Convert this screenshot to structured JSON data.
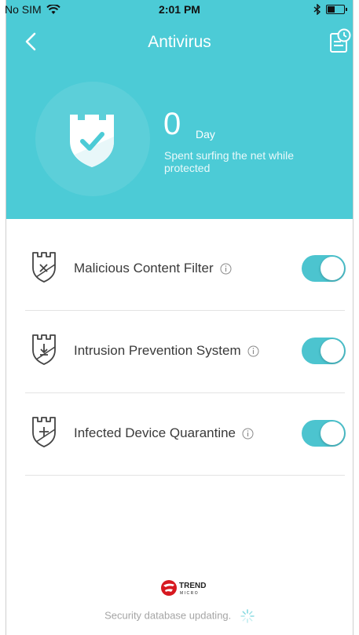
{
  "status_bar": {
    "carrier": "No SIM",
    "time": "2:01 PM",
    "bluetooth_icon": "bluetooth-icon",
    "battery_icon": "battery-icon"
  },
  "header": {
    "title": "Antivirus",
    "back_icon": "chevron-left-icon",
    "history_icon": "history-log-icon",
    "background_color": "#4ccbd6",
    "protection": {
      "days_value": "0",
      "days_unit": "Day",
      "caption": "Spent surfing the net while protected"
    }
  },
  "features": [
    {
      "label": "Malicious Content Filter",
      "icon": "shield-x-icon",
      "enabled": true
    },
    {
      "label": "Intrusion Prevention System",
      "icon": "shield-download-icon",
      "enabled": true
    },
    {
      "label": "Infected Device Quarantine",
      "icon": "shield-plus-icon",
      "enabled": true
    }
  ],
  "toggle_color": "#4cc4cf",
  "footer": {
    "logo_text": "TREND",
    "logo_subtext": "MICRO",
    "status": "Security database updating."
  }
}
